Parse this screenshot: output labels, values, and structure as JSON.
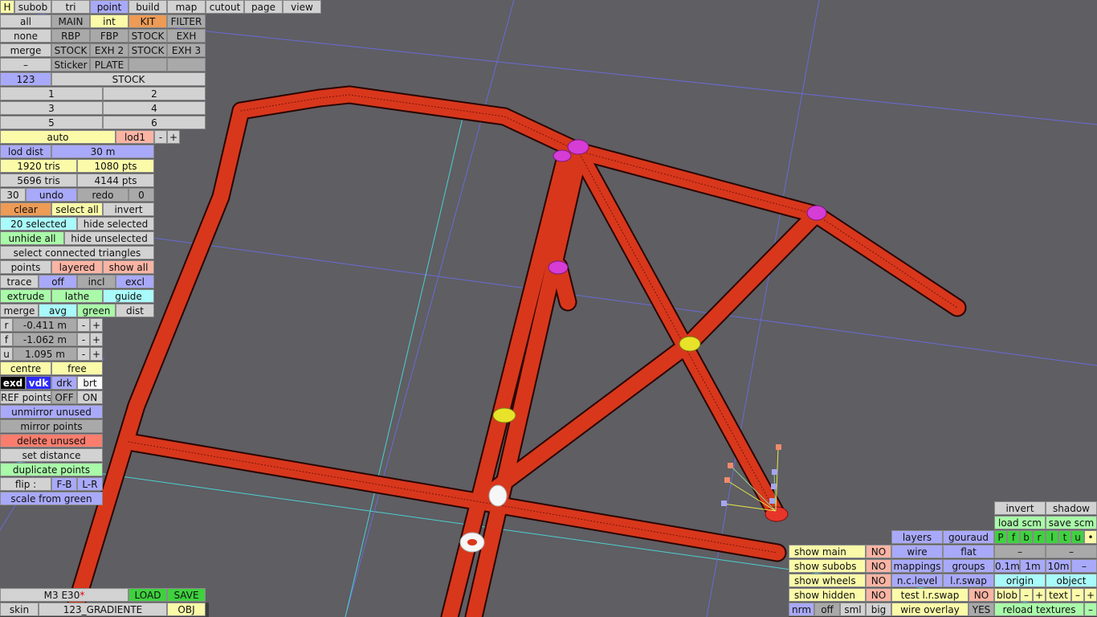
{
  "top_tabs": {
    "h": "H",
    "subob": "subob",
    "tri": "tri",
    "point": "point",
    "build": "build",
    "map": "map",
    "cutout": "cutout",
    "page": "page",
    "view": "view"
  },
  "subob_grid": {
    "r1": [
      "all",
      "MAIN",
      "int",
      "KIT",
      "FILTER"
    ],
    "r2": [
      "none",
      "RBP",
      "FBP",
      "STOCK",
      "EXH"
    ],
    "r3": [
      "merge",
      "STOCK",
      "EXH 2",
      "STOCK",
      "EXH 3"
    ],
    "r4": [
      "–",
      "Sticker",
      "PLATE",
      "",
      ""
    ],
    "num": "123",
    "stock": "STOCK",
    "n": [
      "1",
      "2",
      "3",
      "4",
      "5",
      "6"
    ]
  },
  "lod": {
    "auto": "auto",
    "lod1": "lod1",
    "minus": "-",
    "plus": "+",
    "dist_label": "lod dist",
    "dist_value": "30 m"
  },
  "stats": {
    "tris_sel": "1920 tris",
    "pts_sel": "1080 pts",
    "tris_all": "5696 tris",
    "pts_all": "4144 pts"
  },
  "undo": {
    "count": "30",
    "undo": "undo",
    "redo": "redo",
    "redo_count": "0"
  },
  "sel": {
    "clear": "clear",
    "select_all": "select all",
    "invert": "invert",
    "selected": "20 selected",
    "hide_selected": "hide selected",
    "unhide_all": "unhide all",
    "hide_unselected": "hide unselected",
    "connected": "select connected triangles"
  },
  "mode": {
    "points": "points",
    "layered": "layered",
    "show_all": "show all",
    "trace": "trace",
    "off": "off",
    "incl": "incl",
    "excl": "excl",
    "extrude": "extrude",
    "lathe": "lathe",
    "guide": "guide",
    "merge": "merge",
    "avg": "avg",
    "green": "green",
    "dist": "dist"
  },
  "coords": [
    {
      "axis": "r",
      "value": "-0.411 m"
    },
    {
      "axis": "f",
      "value": "-1.062 m"
    },
    {
      "axis": "u",
      "value": "1.095 m"
    }
  ],
  "pivot": {
    "centre": "centre",
    "free": "free"
  },
  "shade": {
    "exd": "exd",
    "vdk": "vdk",
    "drk": "drk",
    "brt": "brt"
  },
  "refpoints": {
    "label": "REF points",
    "off": "OFF",
    "on": "ON"
  },
  "ops": {
    "unmirror": "unmirror unused",
    "mirror": "mirror points",
    "delete": "delete unused",
    "setdist": "set distance",
    "dup": "duplicate points",
    "flip": "flip :",
    "fb": "F-B",
    "lr": "L-R",
    "scale": "scale from green"
  },
  "bottom_left": {
    "model": "M3 E30",
    "modified": "*",
    "load": "LOAD",
    "save": "SAVE",
    "skin": "skin",
    "skin_name": "123_GRADIENTE",
    "obj": "OBJ"
  },
  "br": {
    "invert": "invert",
    "shadow": "shadow",
    "load_scm": "load scm",
    "save_scm": "save scm",
    "letters": [
      "P",
      "f",
      "b",
      "r",
      "l",
      "t",
      "u",
      "•"
    ],
    "layers": "layers",
    "gouraud": "gouraud",
    "wire": "wire",
    "flat": "flat",
    "mappings": "mappings",
    "groups": "groups",
    "ncl": "n.c.level",
    "lrswap": "l.r.swap",
    "dash1": "–",
    "dash2": "–",
    "d01": "0.1m",
    "d1": "1m",
    "d10": "10m",
    "dminus": "–",
    "origin": "origin",
    "object": "object",
    "show_main": "show main",
    "show_subobs": "show subobs",
    "show_wheels": "show wheels",
    "show_hidden": "show hidden",
    "no": "NO",
    "yes": "YES",
    "test_lr": "test l.r.swap",
    "blob": "blob",
    "text": "text",
    "m": "–",
    "p": "+",
    "nrm": "nrm",
    "off": "off",
    "sml": "sml",
    "big": "big",
    "wire_overlay": "wire overlay",
    "reload": "reload textures"
  }
}
